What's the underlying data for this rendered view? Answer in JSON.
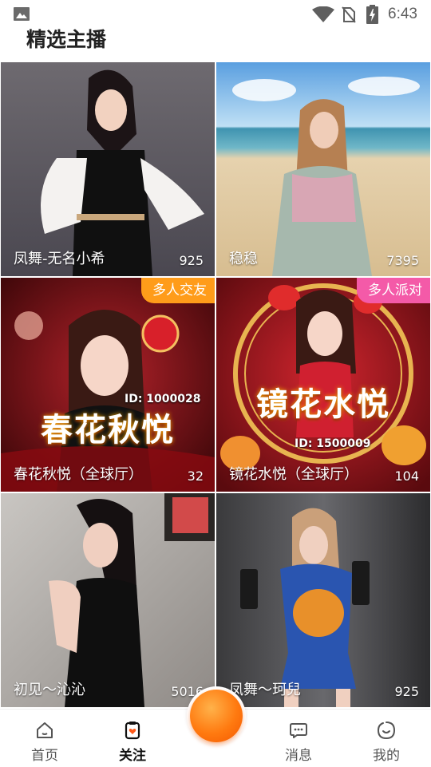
{
  "status_bar": {
    "time": "6:43"
  },
  "section": {
    "title": "精选主播"
  },
  "streams": [
    {
      "name": "凤舞-无名小希",
      "count": "925",
      "tag": ""
    },
    {
      "name": "稳稳",
      "count": "7395",
      "tag": ""
    },
    {
      "name": "春花秋悦（全球厅）",
      "count": "32",
      "tag": "多人交友",
      "poster_title": "春花秋悦",
      "poster_id": "ID: 1000028"
    },
    {
      "name": "镜花水悦（全球厅）",
      "count": "104",
      "tag": "多人派对",
      "poster_title": "镜花水悦",
      "poster_id": "ID: 1500009"
    },
    {
      "name": "初见～沁沁",
      "count": "5016",
      "tag": ""
    },
    {
      "name": "凤舞～珂兒",
      "count": "925",
      "tag": ""
    }
  ],
  "nav": {
    "home": "首页",
    "follow": "关注",
    "messages": "消息",
    "mine": "我的"
  },
  "colors": {
    "accent": "#ff7a10",
    "tag_orange": "#ff9c1a",
    "tag_pink": "#f45aa8"
  }
}
